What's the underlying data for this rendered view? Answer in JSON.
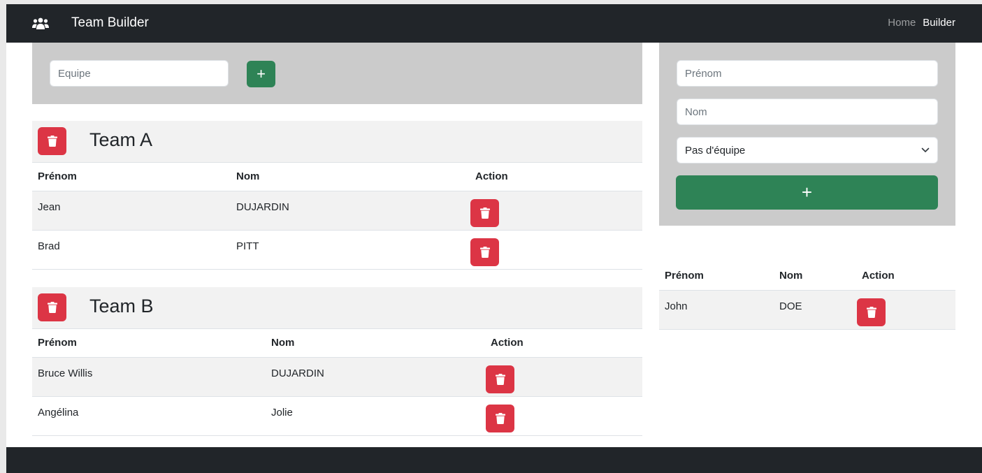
{
  "navbar": {
    "brand_icon": "users-icon",
    "title": "Team Builder",
    "links": [
      {
        "label": "Home",
        "active": false
      },
      {
        "label": "Builder",
        "active": true
      }
    ]
  },
  "team_form": {
    "input_placeholder": "Equipe",
    "input_value": "",
    "add_label": "+"
  },
  "teams": [
    {
      "name": "Team A",
      "columns": [
        "Prénom",
        "Nom",
        "Action"
      ],
      "rows": [
        {
          "prenom": "Jean",
          "nom": "DUJARDIN"
        },
        {
          "prenom": "Brad",
          "nom": "PITT"
        }
      ]
    },
    {
      "name": "Team B",
      "columns": [
        "Prénom",
        "Nom",
        "Action"
      ],
      "rows": [
        {
          "prenom": "Bruce Willis",
          "nom": "DUJARDIN"
        },
        {
          "prenom": "Angélina",
          "nom": "Jolie"
        }
      ]
    }
  ],
  "member_form": {
    "prenom_placeholder": "Prénom",
    "nom_placeholder": "Nom",
    "team_select_value": "Pas d'équipe",
    "add_label": "+"
  },
  "unassigned": {
    "columns": [
      "Prénom",
      "Nom",
      "Action"
    ],
    "rows": [
      {
        "prenom": "John",
        "nom": "DOE"
      }
    ]
  },
  "colors": {
    "navbar": "#212529",
    "green": "#2e8356",
    "red": "#dc3545",
    "panel": "#cbcbcb"
  },
  "icons": {
    "delete": "trash-icon",
    "select": "chevron-down-icon"
  }
}
